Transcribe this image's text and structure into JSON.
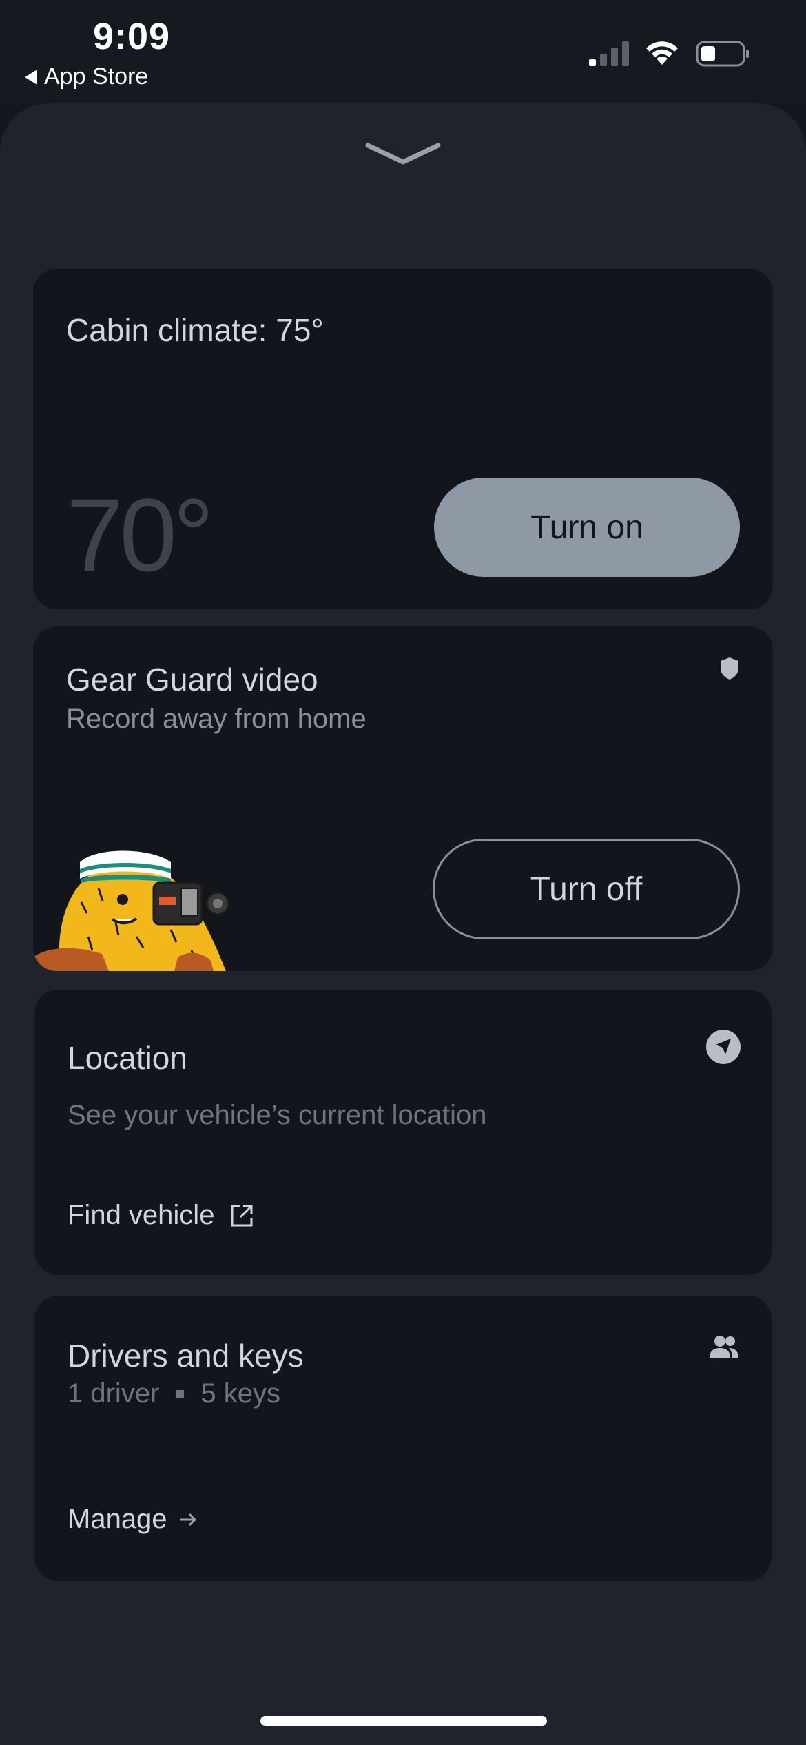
{
  "status_bar": {
    "time": "9:09",
    "back_label": "App Store"
  },
  "climate": {
    "title": "Cabin climate: 75°",
    "current_temp": "70°",
    "button_label": "Turn on"
  },
  "gear_guard": {
    "title": "Gear Guard video",
    "subtitle": "Record away from home",
    "button_label": "Turn off"
  },
  "location": {
    "title": "Location",
    "subtitle": "See your vehicle’s current location",
    "link_label": "Find vehicle"
  },
  "drivers": {
    "title": "Drivers and keys",
    "drivers_count": "1 driver",
    "keys_count": "5 keys",
    "link_label": "Manage"
  },
  "icons": {
    "status": [
      "signal-icon",
      "wifi-icon",
      "battery-icon"
    ],
    "card": [
      "shield-icon",
      "navigation-arrow-icon",
      "people-icon",
      "external-link-icon",
      "arrow-right-icon",
      "chevron-down-icon"
    ]
  },
  "colors": {
    "sheet_bg": "#1f242c",
    "card_bg": "#12151c",
    "primary_button": "#8f99a5"
  }
}
